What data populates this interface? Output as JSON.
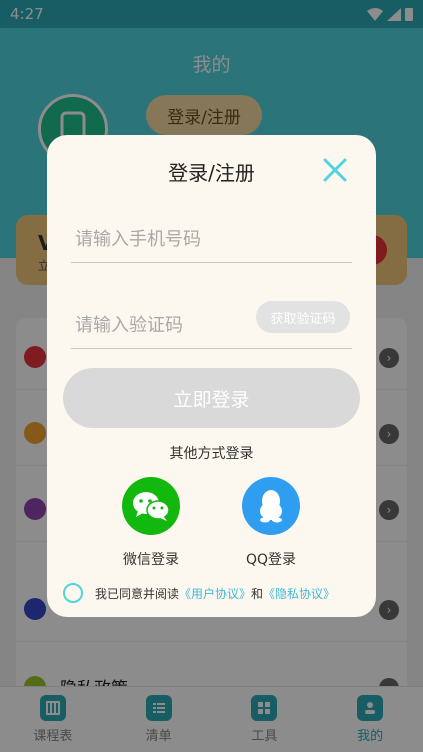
{
  "status_bar": {
    "time": "4:27"
  },
  "page": {
    "title": "我的",
    "login_pill": "登录/注册",
    "vip": {
      "title": "V",
      "subtitle": "立"
    },
    "menu_items": [
      {
        "label": ""
      },
      {
        "label": ""
      },
      {
        "label": ""
      },
      {
        "label": ""
      },
      {
        "label": "隐私政策"
      }
    ]
  },
  "tabbar": {
    "tabs": [
      {
        "label": "课程表"
      },
      {
        "label": "清单"
      },
      {
        "label": "工具"
      },
      {
        "label": "我的"
      }
    ]
  },
  "modal": {
    "title": "登录/注册",
    "phone_placeholder": "请输入手机号码",
    "code_placeholder": "请输入验证码",
    "get_code_label": "获取验证码",
    "login_button": "立即登录",
    "other_methods": "其他方式登录",
    "wechat_label": "微信登录",
    "qq_label": "QQ登录",
    "agreement": {
      "prefix": "我已同意并阅读",
      "user_agreement": "《用户协议》",
      "and": "和",
      "privacy_agreement": "《隐私协议》"
    }
  },
  "colors": {
    "accent": "#4fd3dc",
    "wechat": "#12b80e",
    "qq": "#2f9ef0",
    "link": "#3fb7d6"
  }
}
